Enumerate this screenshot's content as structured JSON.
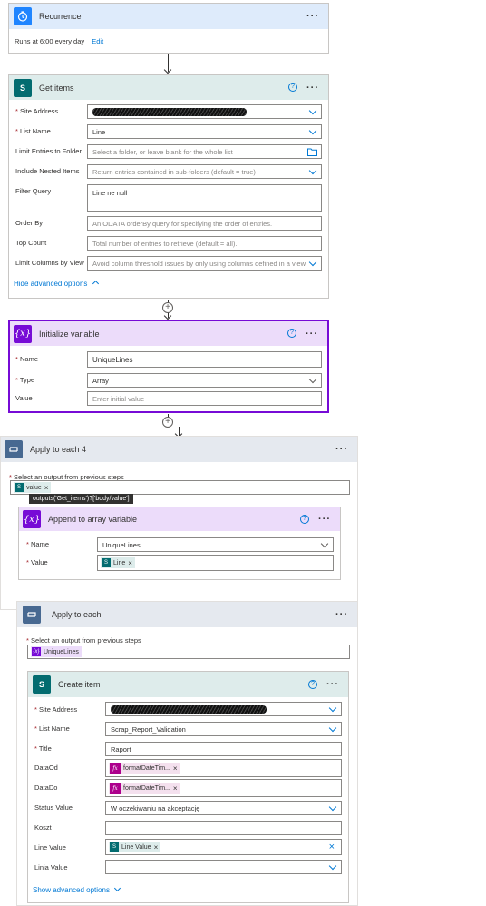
{
  "recurrence": {
    "title": "Recurrence",
    "summary": "Runs at 6:00 every day",
    "edit": "Edit"
  },
  "get_items": {
    "title": "Get items",
    "fields": [
      {
        "label": "Site Address",
        "required": true,
        "value": ""
      },
      {
        "label": "List Name",
        "required": true,
        "value": "Line"
      },
      {
        "label": "Limit Entries to Folder",
        "placeholder": "Select a folder, or leave blank for the whole list"
      },
      {
        "label": "Include Nested Items",
        "placeholder": "Return entries contained in sub-folders (default = true)"
      },
      {
        "label": "Filter Query",
        "value": "Line ne null"
      },
      {
        "label": "Order By",
        "placeholder": "An ODATA orderBy query for specifying the order of entries."
      },
      {
        "label": "Top Count",
        "placeholder": "Total number of entries to retrieve (default = all)."
      },
      {
        "label": "Limit Columns by View",
        "placeholder": "Avoid column threshold issues by only using columns defined in a view"
      }
    ],
    "hide_advanced": "Hide advanced options"
  },
  "init_var": {
    "title": "Initialize variable",
    "name_label": "Name",
    "name_value": "UniqueLines",
    "type_label": "Type",
    "type_value": "Array",
    "value_label": "Value",
    "value_placeholder": "Enter initial value"
  },
  "apply4": {
    "title": "Apply to each 4",
    "select_label": "Select an output from previous steps",
    "token": "value",
    "tooltip": "outputs('Get_items')?['body/value']"
  },
  "append": {
    "title": "Append to array variable",
    "name_label": "Name",
    "name_value": "UniqueLines",
    "value_label": "Value",
    "value_token": "Line"
  },
  "apply": {
    "title": "Apply to each",
    "select_label": "Select an output from previous steps",
    "token": "UniqueLines"
  },
  "create_item": {
    "title": "Create item",
    "site_label": "Site Address",
    "list_label": "List Name",
    "list_value": "Scrap_Report_Validation",
    "title_label": "Title",
    "title_value": "Raport",
    "dataod_label": "DataOd",
    "dataod_token": "formatDateTim...",
    "datado_label": "DataDo",
    "datado_token": "formatDateTim...",
    "status_label": "Status Value",
    "status_value": "W oczekiwaniu na akceptację",
    "koszt_label": "Koszt",
    "line_label": "Line Value",
    "line_token": "Line Value",
    "linia_label": "Linia Value",
    "show_advanced": "Show advanced options"
  },
  "symbols": {
    "var": "{x}",
    "fx": "fx",
    "more": "···",
    "help": "?",
    "close": "×",
    "plus": "+"
  }
}
